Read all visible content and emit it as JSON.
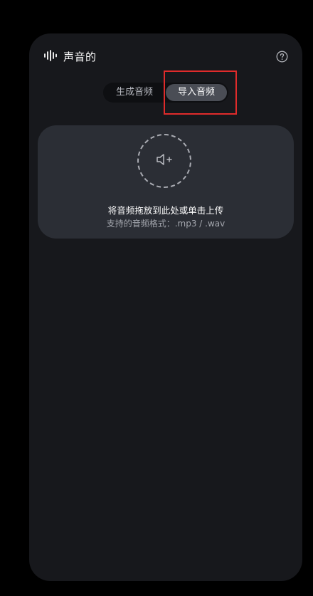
{
  "header": {
    "title": "声音的",
    "title_icon": "waveform-icon",
    "help_icon": "question-circle-icon"
  },
  "tabs": [
    {
      "label": "生成音频",
      "active": false
    },
    {
      "label": "导入音频",
      "active": true
    }
  ],
  "dropzone": {
    "icon": "speaker-plus-icon",
    "title": "将音频拖放到此处或单击上传",
    "subtitle": "支持的音频格式：.mp3 / .wav"
  },
  "colors": {
    "background": "#000000",
    "panel": "#17181c",
    "dropzone": "#2b2e35",
    "active_tab": "#4a4d55",
    "highlight_border": "#e02b2b"
  }
}
